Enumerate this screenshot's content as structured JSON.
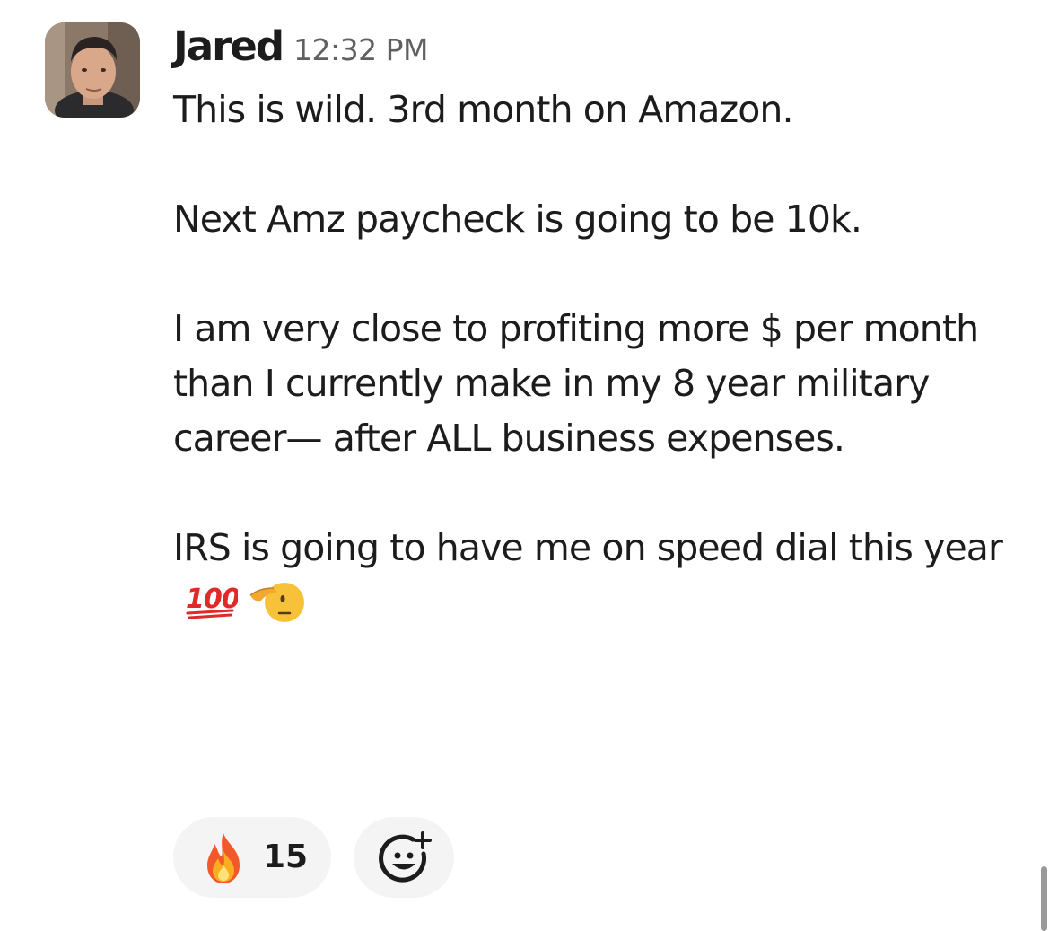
{
  "message": {
    "sender": "Jared",
    "timestamp": "12:32 PM",
    "avatar_icon": "user-photo-avatar",
    "paragraphs": [
      "This is wild. 3rd month on Amazon.",
      "Next Amz paycheck is going to be 10k.",
      "I am very close to profiting more $ per month than I currently make in my 8 year military career— after ALL business expenses.",
      "IRS is going to have me on speed dial this year"
    ],
    "trailing_emojis": [
      "hundred-points-icon",
      "saluting-face-icon"
    ]
  },
  "reactions": [
    {
      "emoji": "fire-icon",
      "count": "15"
    }
  ],
  "add_reaction_icon": "add-emoji-reaction-icon",
  "colors": {
    "text": "#1d1c1d",
    "timestamp": "#616061",
    "pill_background": "#f4f4f4",
    "scrollbar": "#9a9a9a"
  }
}
